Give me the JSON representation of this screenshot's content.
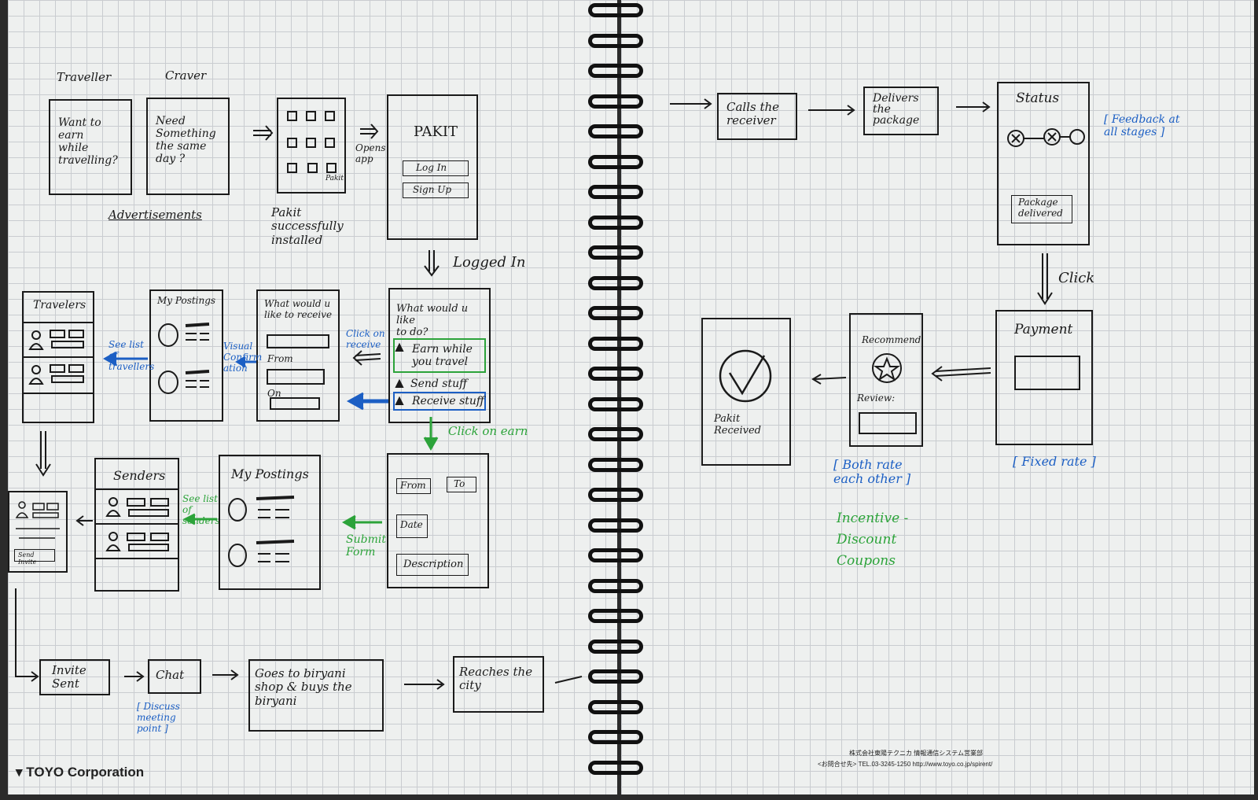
{
  "left": {
    "labels": {
      "traveller": "Traveller",
      "craver": "Craver",
      "ads": "Advertisements",
      "installed": "Pakit\nsuccessfully\ninstalled",
      "opens_app": "Opens\napp",
      "logged_in": "Logged In",
      "see_list_travellers": "See list\nof\ntravellers",
      "visual_confirmation": "Visual\nConfirm\nation",
      "click_on_receive": "Click on\nreceive",
      "click_on_earn": "Click on earn",
      "submit_form": "Submit\nForm",
      "see_list_senders": "See list\nof\nsenders",
      "discuss_meeting": "[ Discuss\nmeeting\npoint ]"
    },
    "ad_traveller": "Want to\nearn\nwhile\ntravelling?",
    "ad_craver": "Need\nSomething\nthe same\nday ?",
    "phone_icon_label": "Pakit",
    "pakit_title": "PAKIT",
    "login": "Log In",
    "signup": "Sign Up",
    "what_to_do": "What would u like\nto do?",
    "earn": "Earn while\nyou travel",
    "send": "Send stuff",
    "receive": "Receive stuff",
    "receive_form": "What would u\nlike to receive",
    "from": "From",
    "on": "On",
    "my_postings": "My Postings",
    "travelers": "Travelers",
    "senders": "Senders",
    "form_from": "From",
    "form_to": "To",
    "form_date": "Date",
    "form_description": "Description",
    "send_invite": "Send Invite",
    "invite_sent": "Invite\nSent",
    "chat": "Chat",
    "goes_to": "Goes to biryani\nshop & buys the\nbiryani",
    "reaches": "Reaches the\ncity",
    "footer_brand": "TOYO Corporation"
  },
  "right": {
    "calls_receiver": "Calls the\nreceiver",
    "delivers": "Delivers\nthe\npackage",
    "status": "Status",
    "package_delivered": "Package\ndelivered",
    "feedback": "[ Feedback at\nall stages ]",
    "click": "Click",
    "payment": "Payment",
    "fixed_rate": "[ Fixed rate ]",
    "recommend": "Recommend",
    "review": "Review:",
    "both_rate": "[ Both rate\neach other ]",
    "incentive": "Incentive -\nDiscount\nCoupons",
    "pakit_received": "Pakit Received",
    "footer_company": "株式会社東陽テクニカ 情報通信システム営業部",
    "footer_contact": "<お問合せ先> TEL.03-3245-1250 http://www.toyo.co.jp/spirent/"
  },
  "colors": {
    "ink": "#1a1a1a",
    "blue": "#1c5fc4",
    "green": "#2ca33a",
    "paper": "#eef0ef"
  }
}
